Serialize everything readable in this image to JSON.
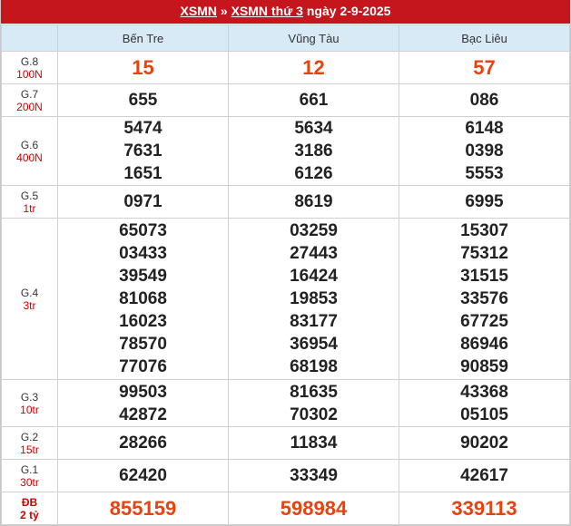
{
  "title": {
    "link1": "XSMN",
    "sep": "»",
    "link2": "XSMN thứ 3",
    "date": "ngày 2-9-2025"
  },
  "provinces": [
    "Bến Tre",
    "Vũng Tàu",
    "Bạc Liêu"
  ],
  "prizes": [
    {
      "key": "g8",
      "label": "G.8",
      "amount": "100N",
      "values": [
        [
          "15"
        ],
        [
          "12"
        ],
        [
          "57"
        ]
      ]
    },
    {
      "key": "g7",
      "label": "G.7",
      "amount": "200N",
      "values": [
        [
          "655"
        ],
        [
          "661"
        ],
        [
          "086"
        ]
      ]
    },
    {
      "key": "g6",
      "label": "G.6",
      "amount": "400N",
      "values": [
        [
          "5474",
          "7631",
          "1651"
        ],
        [
          "5634",
          "3186",
          "6126"
        ],
        [
          "6148",
          "0398",
          "5553"
        ]
      ]
    },
    {
      "key": "g5",
      "label": "G.5",
      "amount": "1tr",
      "values": [
        [
          "0971"
        ],
        [
          "8619"
        ],
        [
          "6995"
        ]
      ]
    },
    {
      "key": "g4",
      "label": "G.4",
      "amount": "3tr",
      "values": [
        [
          "65073",
          "03433",
          "39549",
          "81068",
          "16023",
          "78570",
          "77076"
        ],
        [
          "03259",
          "27443",
          "16424",
          "19853",
          "83177",
          "36954",
          "68198"
        ],
        [
          "15307",
          "75312",
          "31515",
          "33576",
          "67725",
          "86946",
          "90859"
        ]
      ]
    },
    {
      "key": "g3",
      "label": "G.3",
      "amount": "10tr",
      "values": [
        [
          "99503",
          "42872"
        ],
        [
          "81635",
          "70302"
        ],
        [
          "43368",
          "05105"
        ]
      ]
    },
    {
      "key": "g2",
      "label": "G.2",
      "amount": "15tr",
      "values": [
        [
          "28266"
        ],
        [
          "11834"
        ],
        [
          "90202"
        ]
      ]
    },
    {
      "key": "g1",
      "label": "G.1",
      "amount": "30tr",
      "values": [
        [
          "62420"
        ],
        [
          "33349"
        ],
        [
          "42617"
        ]
      ]
    },
    {
      "key": "db",
      "label": "ĐB",
      "amount": "2 tỷ",
      "values": [
        [
          "855159"
        ],
        [
          "598984"
        ],
        [
          "339113"
        ]
      ]
    }
  ]
}
